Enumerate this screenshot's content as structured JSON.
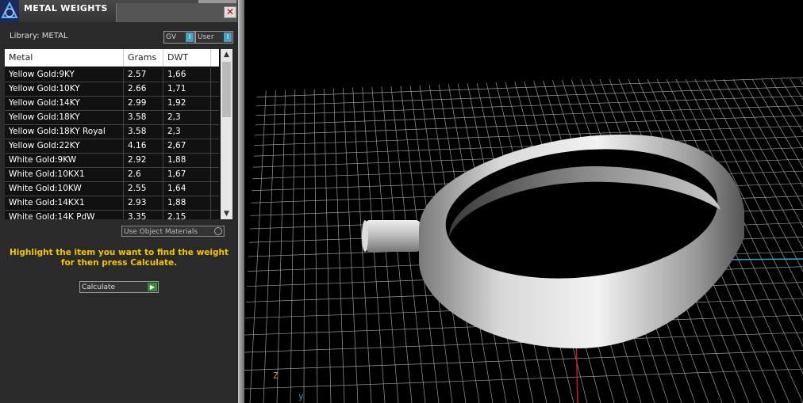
{
  "window": {
    "title": "METAL WEIGHTS",
    "close_glyph": "✕"
  },
  "library": {
    "label": "Library: METAL"
  },
  "toggles": {
    "gv": "GV",
    "user": "User",
    "indicator": "I"
  },
  "table": {
    "headers": [
      "Metal",
      "Grams",
      "DWT"
    ],
    "rows": [
      {
        "metal": "Yellow Gold:9KY",
        "grams": "2.57",
        "dwt": "1,66"
      },
      {
        "metal": "Yellow Gold:10KY",
        "grams": "2.66",
        "dwt": "1,71"
      },
      {
        "metal": "Yellow Gold:14KY",
        "grams": "2.99",
        "dwt": "1,92"
      },
      {
        "metal": "Yellow Gold:18KY",
        "grams": "3.58",
        "dwt": "2,3"
      },
      {
        "metal": "Yellow Gold:18KY Royal",
        "grams": "3.58",
        "dwt": "2,3"
      },
      {
        "metal": "Yellow Gold:22KY",
        "grams": "4.16",
        "dwt": "2,67"
      },
      {
        "metal": "White Gold:9KW",
        "grams": "2.92",
        "dwt": "1,88"
      },
      {
        "metal": "White Gold:10KX1",
        "grams": "2.6",
        "dwt": "1,67"
      },
      {
        "metal": "White Gold:10KW",
        "grams": "2.55",
        "dwt": "1,64"
      },
      {
        "metal": "White Gold:14KX1",
        "grams": "2.93",
        "dwt": "1,88"
      },
      {
        "metal": "White Gold:14K PdW",
        "grams": "3.35",
        "dwt": "2,15"
      }
    ]
  },
  "use_object_materials": "Use Object Materials",
  "hint": "Highlight the item you want to find the weight for then press Calculate.",
  "calculate_label": "Calculate",
  "viewport": {
    "axis_z": "Z",
    "axis_y": "y"
  },
  "colors": {
    "hint": "#f5c400",
    "grid": "#9a9a9a",
    "axis_x": "#3aa0c9",
    "axis_y": "#c0202a",
    "ring": "#c8c8c8"
  }
}
